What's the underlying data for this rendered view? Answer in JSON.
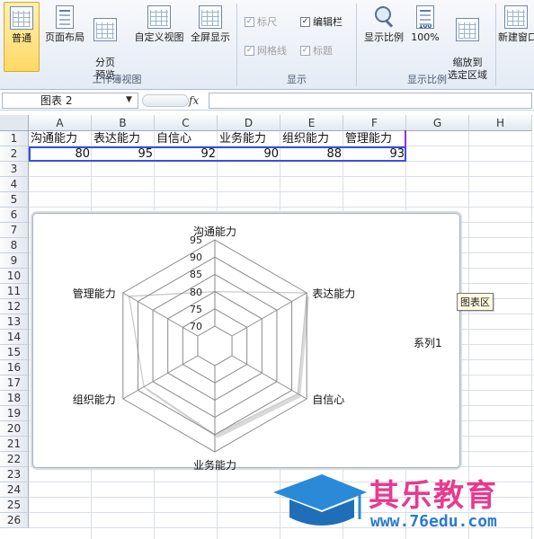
{
  "ribbon": {
    "workbook_views": {
      "group_label": "工作簿视图",
      "normal": "普通",
      "page_layout": "页面布局",
      "page_break_preview": "分页\n预览",
      "custom_views": "自定义视图",
      "full_screen": "全屏显示"
    },
    "show": {
      "group_label": "显示",
      "ruler": "标尺",
      "formula_bar": "编辑栏",
      "gridlines": "网格线",
      "headings": "标题"
    },
    "zoom": {
      "group_label": "显示比例",
      "zoom": "显示比例",
      "hundred": "100%",
      "zoom_to_selection": "缩放到\n选定区域",
      "hundred_icon_text": "100"
    },
    "window": {
      "new_window": "新建窗口"
    }
  },
  "formula_bar": {
    "name_box": "图表 2",
    "fx": "fx",
    "value": ""
  },
  "sheet": {
    "columns": [
      "A",
      "B",
      "C",
      "D",
      "E",
      "F",
      "G",
      "H"
    ],
    "rows": [
      "1",
      "2",
      "3",
      "4",
      "5",
      "6",
      "7",
      "8",
      "9",
      "10",
      "11",
      "12",
      "13",
      "14",
      "15",
      "16",
      "17",
      "18",
      "19",
      "20",
      "21",
      "22",
      "23",
      "24",
      "25",
      "26"
    ],
    "header_row": [
      "沟通能力",
      "表达能力",
      "自信心",
      "业务能力",
      "组织能力",
      "管理能力"
    ],
    "value_row": [
      "80",
      "95",
      "92",
      "90",
      "88",
      "93"
    ]
  },
  "chart_data": {
    "type": "radar",
    "categories": [
      "沟通能力",
      "表达能力",
      "自信心",
      "业务能力",
      "组织能力",
      "管理能力"
    ],
    "series": [
      {
        "name": "系列1",
        "values": [
          80,
          95,
          92,
          90,
          88,
          93
        ]
      }
    ],
    "rlim": [
      70,
      95
    ],
    "ticks": [
      "70",
      "75",
      "80",
      "85",
      "90",
      "95"
    ],
    "legend": "right",
    "colors": {
      "series": "#ffffff",
      "series_outline": "#c8c8c8",
      "grid": "#8a8a8a"
    }
  },
  "tooltip": "图表区",
  "watermark": {
    "brand": "其乐教育",
    "url": "www.76edu.com"
  }
}
